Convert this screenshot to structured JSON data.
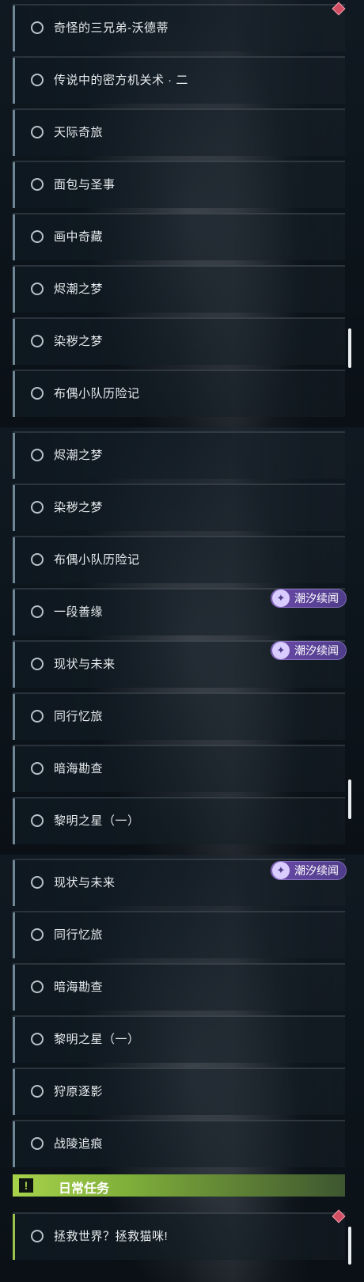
{
  "screen1": {
    "quests": [
      {
        "label": "奇怪的三兄弟-沃德蒂"
      },
      {
        "label": "传说中的密方机关术 · 二"
      },
      {
        "label": "天际奇旅"
      },
      {
        "label": "面包与圣事"
      },
      {
        "label": "画中奇藏"
      },
      {
        "label": "烬潮之梦"
      },
      {
        "label": "染秽之梦"
      },
      {
        "label": "布偶小队历险记"
      }
    ]
  },
  "screen2": {
    "quests": [
      {
        "label": "烬潮之梦"
      },
      {
        "label": "染秽之梦"
      },
      {
        "label": "布偶小队历险记"
      },
      {
        "label": "一段善缘"
      },
      {
        "label": "现状与未来"
      },
      {
        "label": "同行忆旅"
      },
      {
        "label": "暗海勘查"
      },
      {
        "label": "黎明之星（一）"
      }
    ],
    "badges": [
      {
        "label": "潮汐续闻"
      },
      {
        "label": "潮汐续闻"
      }
    ]
  },
  "screen3": {
    "quests": [
      {
        "label": "现状与未来"
      },
      {
        "label": "同行忆旅"
      },
      {
        "label": "暗海勘查"
      },
      {
        "label": "黎明之星（一）"
      },
      {
        "label": "狩原逐影"
      },
      {
        "label": "战陵追痕"
      }
    ],
    "badges": [
      {
        "label": "潮汐续闻"
      }
    ],
    "daily_section": {
      "icon": "!",
      "title": "日常任务",
      "quests": [
        {
          "label": "拯救世界？拯救猫咪!"
        }
      ]
    }
  },
  "colors": {
    "badge": "#6a4aa8",
    "daily_header": "#a7d34b",
    "tracked_marker": "#d14d62"
  }
}
